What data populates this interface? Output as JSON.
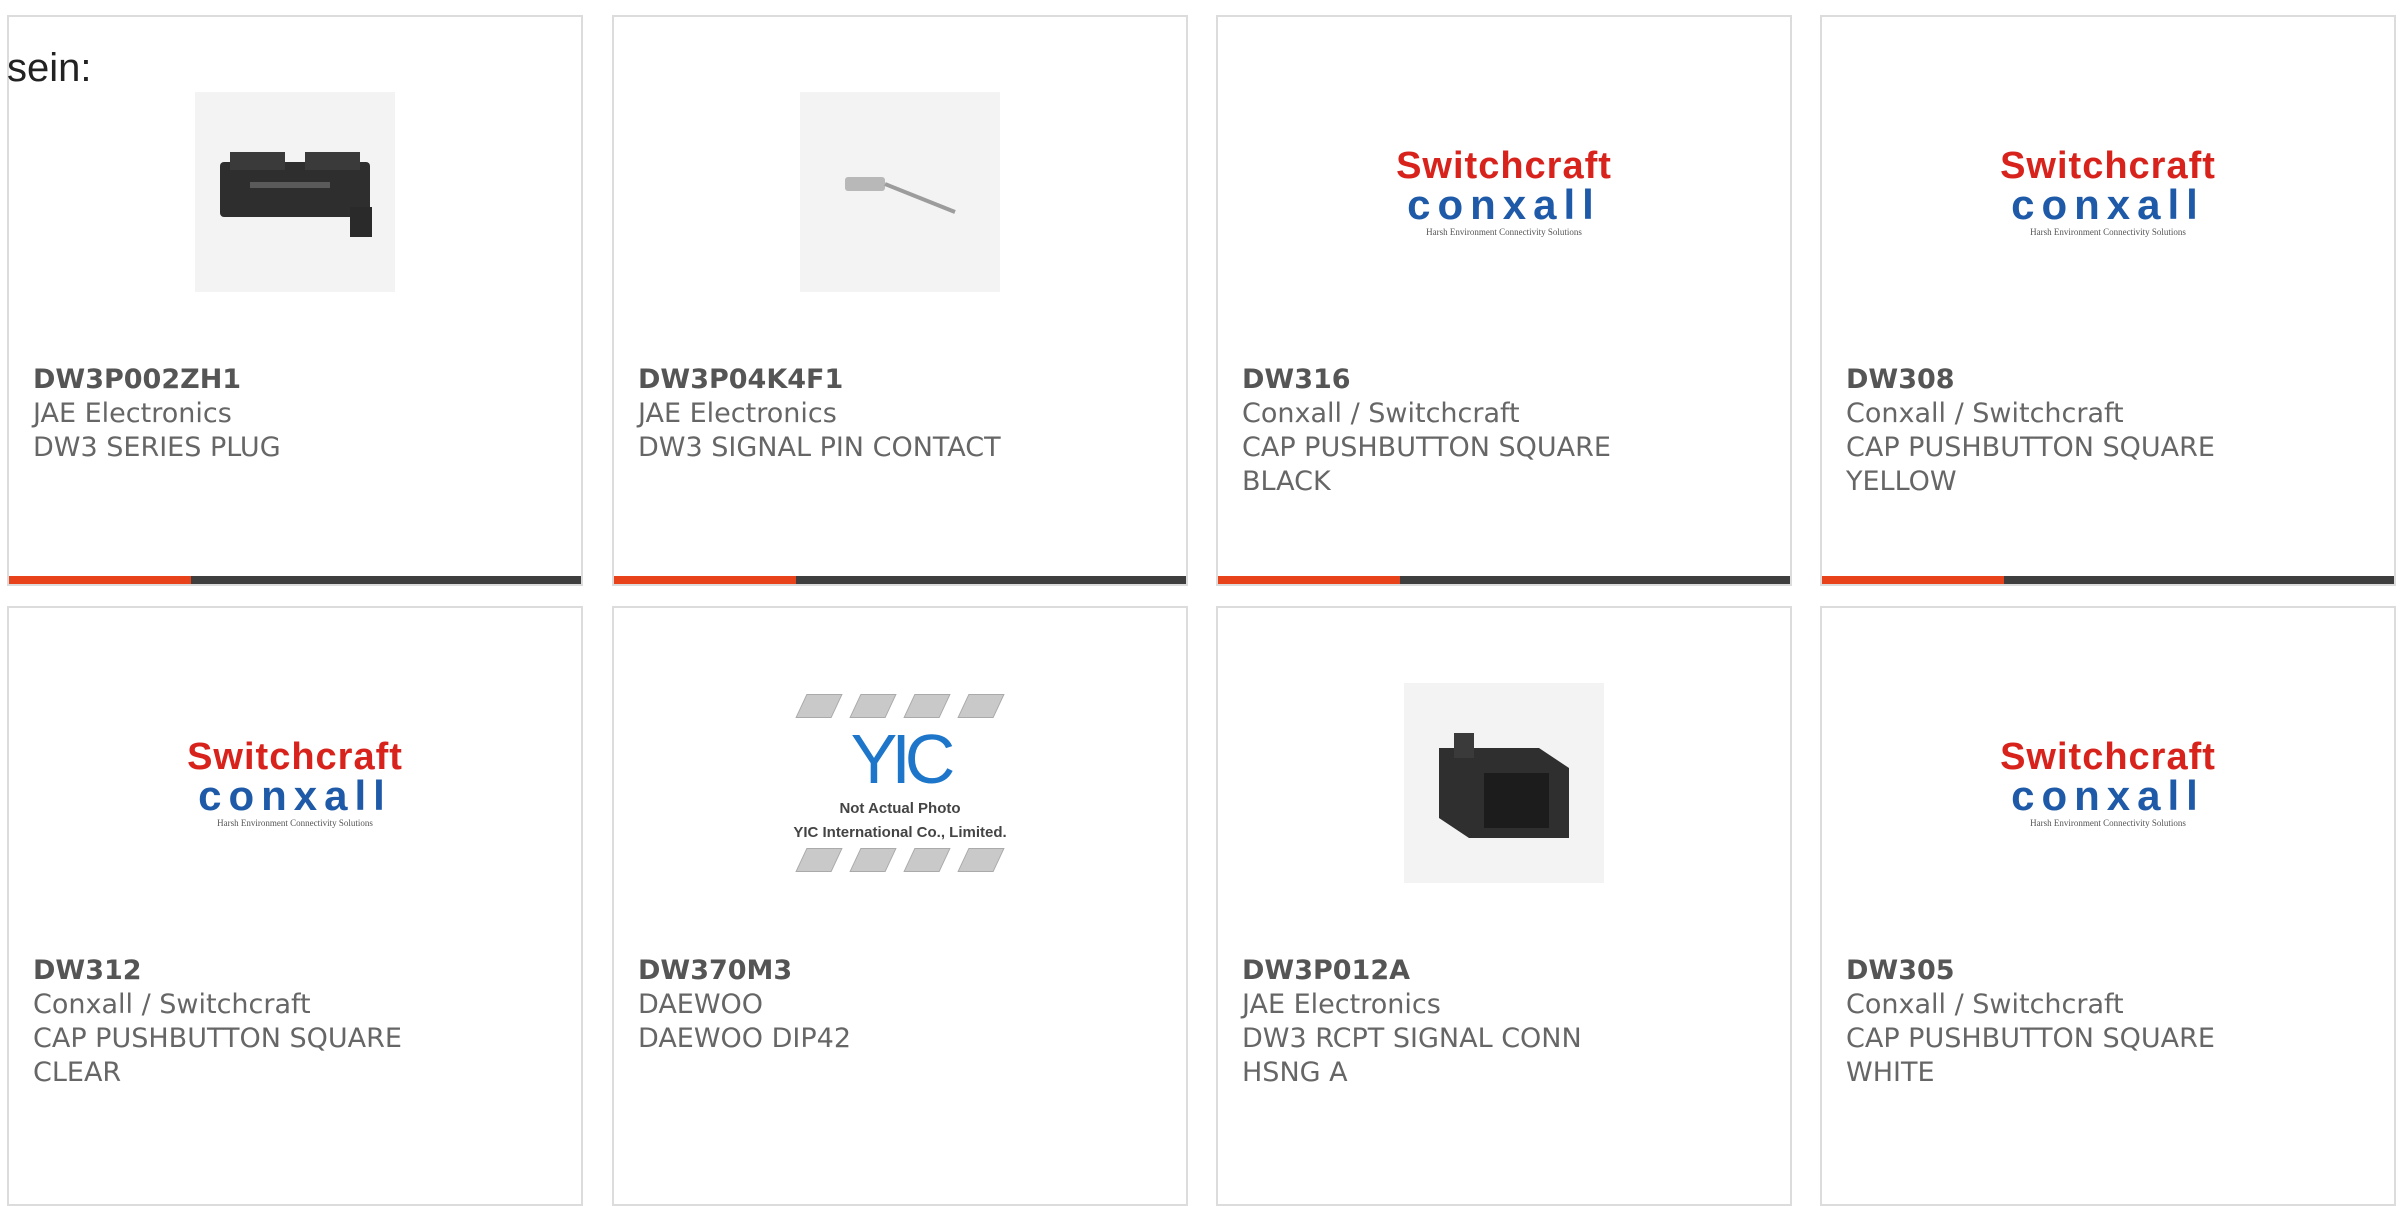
{
  "lead_text": "sein:",
  "accent_color": "#e8421a",
  "products": [
    {
      "part": "DW3P002ZH1",
      "maker": "JAE Electronics",
      "desc": "DW3 SERIES PLUG",
      "image": "connector-plug-photo"
    },
    {
      "part": "DW3P04K4F1",
      "maker": "JAE Electronics",
      "desc": "DW3 SIGNAL PIN CONTACT",
      "image": "pin-contact-photo"
    },
    {
      "part": "DW316",
      "maker": "Conxall / Switchcraft",
      "desc": "CAP PUSHBUTTON SQUARE BLACK",
      "image": "switchcraft-conxall-logo"
    },
    {
      "part": "DW308",
      "maker": "Conxall / Switchcraft",
      "desc": "CAP PUSHBUTTON SQUARE YELLOW",
      "image": "switchcraft-conxall-logo"
    },
    {
      "part": "DW312",
      "maker": "Conxall / Switchcraft",
      "desc": "CAP PUSHBUTTON SQUARE CLEAR",
      "image": "switchcraft-conxall-logo"
    },
    {
      "part": "DW370M3",
      "maker": "DAEWOO",
      "desc": "DAEWOO DIP42",
      "image": "yic-not-actual-photo"
    },
    {
      "part": "DW3P012A",
      "maker": "JAE Electronics",
      "desc": "DW3 RCPT SIGNAL CONN HSNG A",
      "image": "connector-housing-photo"
    },
    {
      "part": "DW305",
      "maker": "Conxall / Switchcraft",
      "desc": "CAP PUSHBUTTON SQUARE WHITE",
      "image": "switchcraft-conxall-logo"
    }
  ],
  "logo": {
    "line1": "Switchcraft",
    "line2": "conxall",
    "tagline": "Harsh Environment Connectivity Solutions"
  },
  "yic": {
    "mark": "YIC",
    "caption_line1": "Not Actual Photo",
    "caption_line2": "YIC International Co., Limited."
  }
}
